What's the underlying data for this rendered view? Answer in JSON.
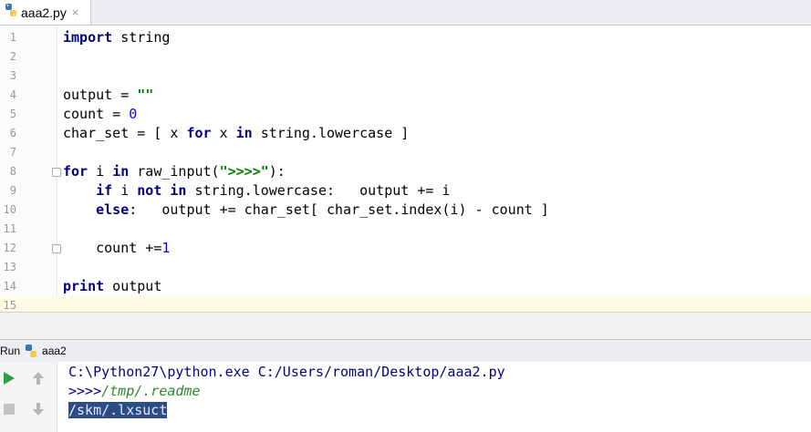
{
  "tab": {
    "label": "aaa2.py",
    "close": "×"
  },
  "editor": {
    "lines": [
      {
        "n": "1"
      },
      {
        "n": "2"
      },
      {
        "n": "3"
      },
      {
        "n": "4"
      },
      {
        "n": "5"
      },
      {
        "n": "6"
      },
      {
        "n": "7"
      },
      {
        "n": "8"
      },
      {
        "n": "9"
      },
      {
        "n": "10"
      },
      {
        "n": "11"
      },
      {
        "n": "12"
      },
      {
        "n": "13"
      },
      {
        "n": "14"
      },
      {
        "n": "15"
      }
    ],
    "code": {
      "l1a": "import",
      "l1b": " string",
      "l4a": "output = ",
      "l4b": "\"\"",
      "l5a": "count = ",
      "l5b": "0",
      "l6a": "char_set = [ x ",
      "l6b": "for",
      "l6c": " x ",
      "l6d": "in",
      "l6e": " string.lowercase ]",
      "l8a": "for",
      "l8b": " i ",
      "l8c": "in",
      "l8d": " raw_input(",
      "l8e": "\">>>>\"",
      "l8f": "):",
      "l9a": "    ",
      "l9b": "if",
      "l9c": " i ",
      "l9d": "not in",
      "l9e": " string.lowercase:   output += i",
      "l10a": "    ",
      "l10b": "else",
      "l10c": ":   output += char_set[ char_set.index(i) - count ]",
      "l12a": "    count +=",
      "l12b": "1",
      "l14a": "print",
      "l14b": " output"
    }
  },
  "run": {
    "title": "Run",
    "name": "aaa2"
  },
  "console": {
    "cmd": "C:\\Python27\\python.exe C:/Users/roman/Desktop/aaa2.py",
    "prompt": ">>>>",
    "input": "/tmp/.readme",
    "output": "/skm/.lxsuct"
  },
  "colors": {
    "keyword": "#000080",
    "string": "#008000",
    "number": "#0000ff",
    "selection": "#2b4c84"
  }
}
